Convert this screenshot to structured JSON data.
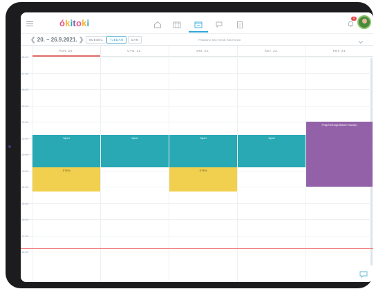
{
  "app": {
    "logo_parts": [
      "ó",
      "k",
      "i",
      "t",
      "o",
      "k",
      "i"
    ]
  },
  "header": {
    "nav_icons": [
      "home-icon",
      "calendar-grid-icon",
      "calendar-week-icon",
      "chat-icon",
      "clipboard-icon"
    ],
    "notification_count": "5"
  },
  "toolbar": {
    "date_range": "20. – 26.9.2021.",
    "views": [
      "MJESEC",
      "TJEDAN",
      "DAN"
    ],
    "active_view": "TJEDAN",
    "filters": "Prikazano: Mia Horvat, Mia Horvat"
  },
  "calendar": {
    "days": [
      "PON. 20.",
      "UTO. 21.",
      "SRI. 22.",
      "ČET. 23.",
      "PET. 24."
    ],
    "times": [
      "06:00",
      "07:00",
      "08:00",
      "09:00",
      "10:00",
      "11:00",
      "12:00",
      "13:00",
      "14:00",
      "15:00",
      "16:00",
      "17:00",
      "18:00"
    ],
    "events": [
      {
        "day": 0,
        "title": "Sport",
        "kind": "sport",
        "start": 10.8,
        "end": 12.8
      },
      {
        "day": 1,
        "title": "Sport",
        "kind": "sport",
        "start": 10.8,
        "end": 12.8
      },
      {
        "day": 2,
        "title": "Sport",
        "kind": "sport",
        "start": 10.8,
        "end": 12.8
      },
      {
        "day": 3,
        "title": "Sport",
        "kind": "sport",
        "start": 10.8,
        "end": 12.8
      },
      {
        "day": 0,
        "title": "STEM",
        "kind": "sten",
        "start": 12.8,
        "end": 14.3
      },
      {
        "day": 2,
        "title": "STEM",
        "kind": "sten",
        "start": 12.8,
        "end": 14.3
      },
      {
        "day": 4,
        "title": "Posjet Etnografskom muzeju",
        "kind": "pojet",
        "start": 10.0,
        "end": 14.0
      }
    ],
    "now_time": 17.8
  },
  "colors": {
    "accent": "#2ea7d8",
    "sport": "#28a9b4",
    "sten": "#f2d04f",
    "pojet": "#9361a8",
    "today": "#e26b6b"
  }
}
